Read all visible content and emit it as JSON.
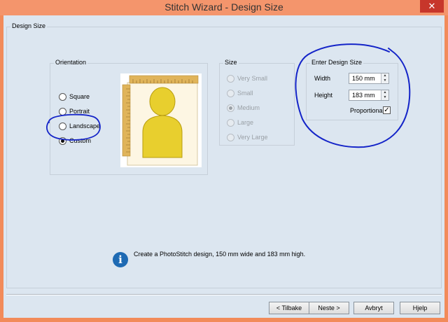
{
  "window": {
    "title": "Stitch Wizard - Design Size",
    "close_glyph": "✕"
  },
  "design_size": {
    "label": "Design Size"
  },
  "orientation": {
    "label": "Orientation",
    "options": [
      {
        "label": "Square",
        "checked": false
      },
      {
        "label": "Portrait",
        "checked": false
      },
      {
        "label": "Landscape",
        "checked": false
      },
      {
        "label": "Custom",
        "checked": true
      }
    ]
  },
  "size": {
    "label": "Size",
    "options": [
      {
        "label": "Very Small",
        "checked": false
      },
      {
        "label": "Small",
        "checked": false
      },
      {
        "label": "Medium",
        "checked": true
      },
      {
        "label": "Large",
        "checked": false
      },
      {
        "label": "Very Large",
        "checked": false
      }
    ]
  },
  "enter_size": {
    "label": "Enter Design Size",
    "width_label": "Width",
    "width_value": "150 mm",
    "height_label": "Height",
    "height_value": "183 mm",
    "proportional_label": "Proportional",
    "proportional_checked": true,
    "check_glyph": "✓",
    "spin_up": "▲",
    "spin_down": "▼"
  },
  "info": {
    "icon": "info-icon",
    "glyph": "i",
    "text": "Create a PhotoStitch design, 150 mm wide and 183 mm high."
  },
  "buttons": {
    "back": "< Tilbake",
    "next": "Neste >",
    "cancel": "Avbryt",
    "help": "Hjelp"
  },
  "colors": {
    "titlebar": "#f4956c",
    "client_bg": "#dce6f0",
    "figure": "#e8cf2e",
    "ruler": "#e0b45a",
    "annotation": "#1424c8",
    "info_icon": "#1e6ab3"
  }
}
